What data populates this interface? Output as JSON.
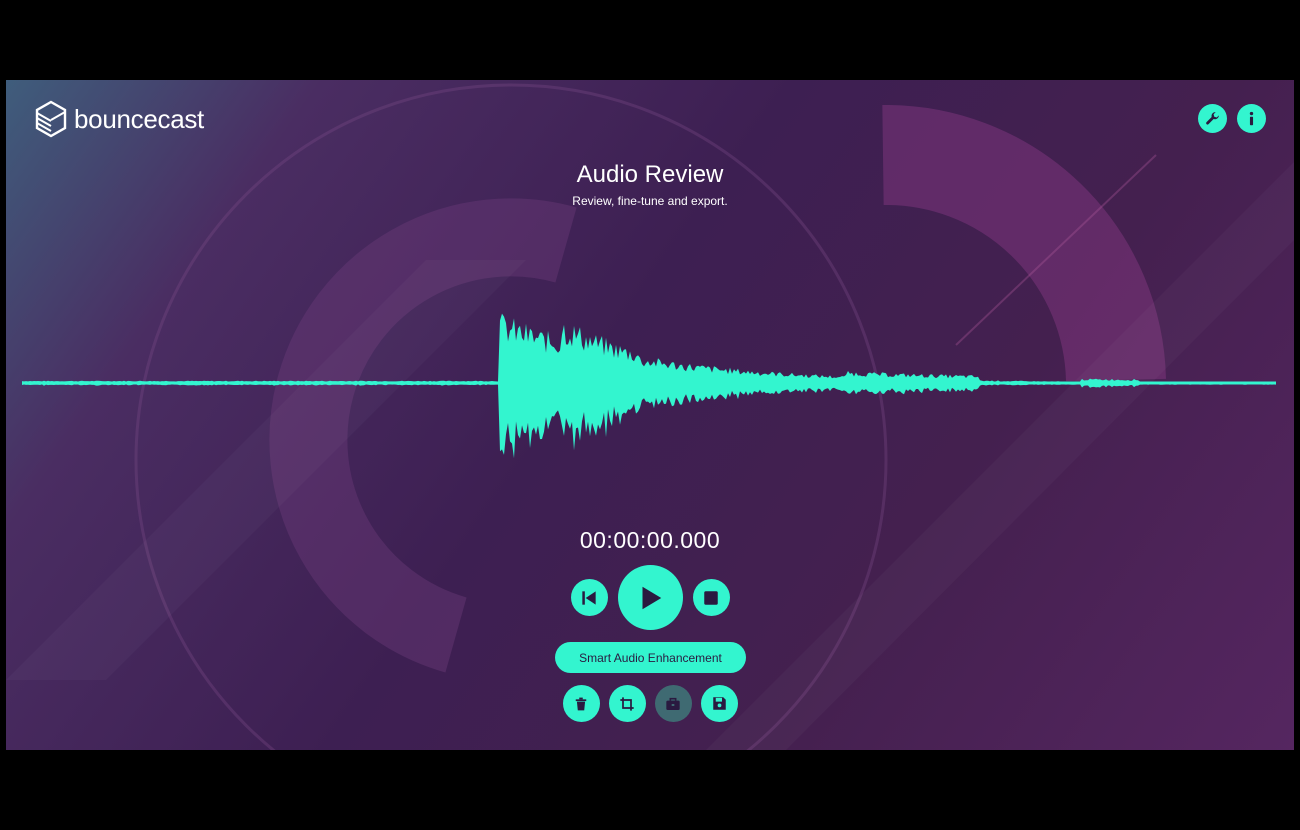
{
  "app": {
    "name": "bouncecast",
    "accent": "#33f5cf"
  },
  "header": {
    "logo_icon": "stacked-layers-logo-icon",
    "actions": [
      {
        "icon": "wrench-icon"
      },
      {
        "icon": "info-icon"
      }
    ]
  },
  "page": {
    "title": "Audio Review",
    "subtitle": "Review, fine-tune and export."
  },
  "player": {
    "time": "00:00:00.000",
    "controls": [
      {
        "icon": "skip-to-start-icon"
      },
      {
        "icon": "play-icon"
      },
      {
        "icon": "stop-icon"
      }
    ],
    "progress": 0
  },
  "enhance_button": {
    "label": "Smart Audio Enhancement"
  },
  "tools": [
    {
      "icon": "trash-icon",
      "enabled": true
    },
    {
      "icon": "crop-icon",
      "enabled": true
    },
    {
      "icon": "briefcase-icon",
      "enabled": false
    },
    {
      "icon": "save-icon",
      "enabled": true
    }
  ]
}
